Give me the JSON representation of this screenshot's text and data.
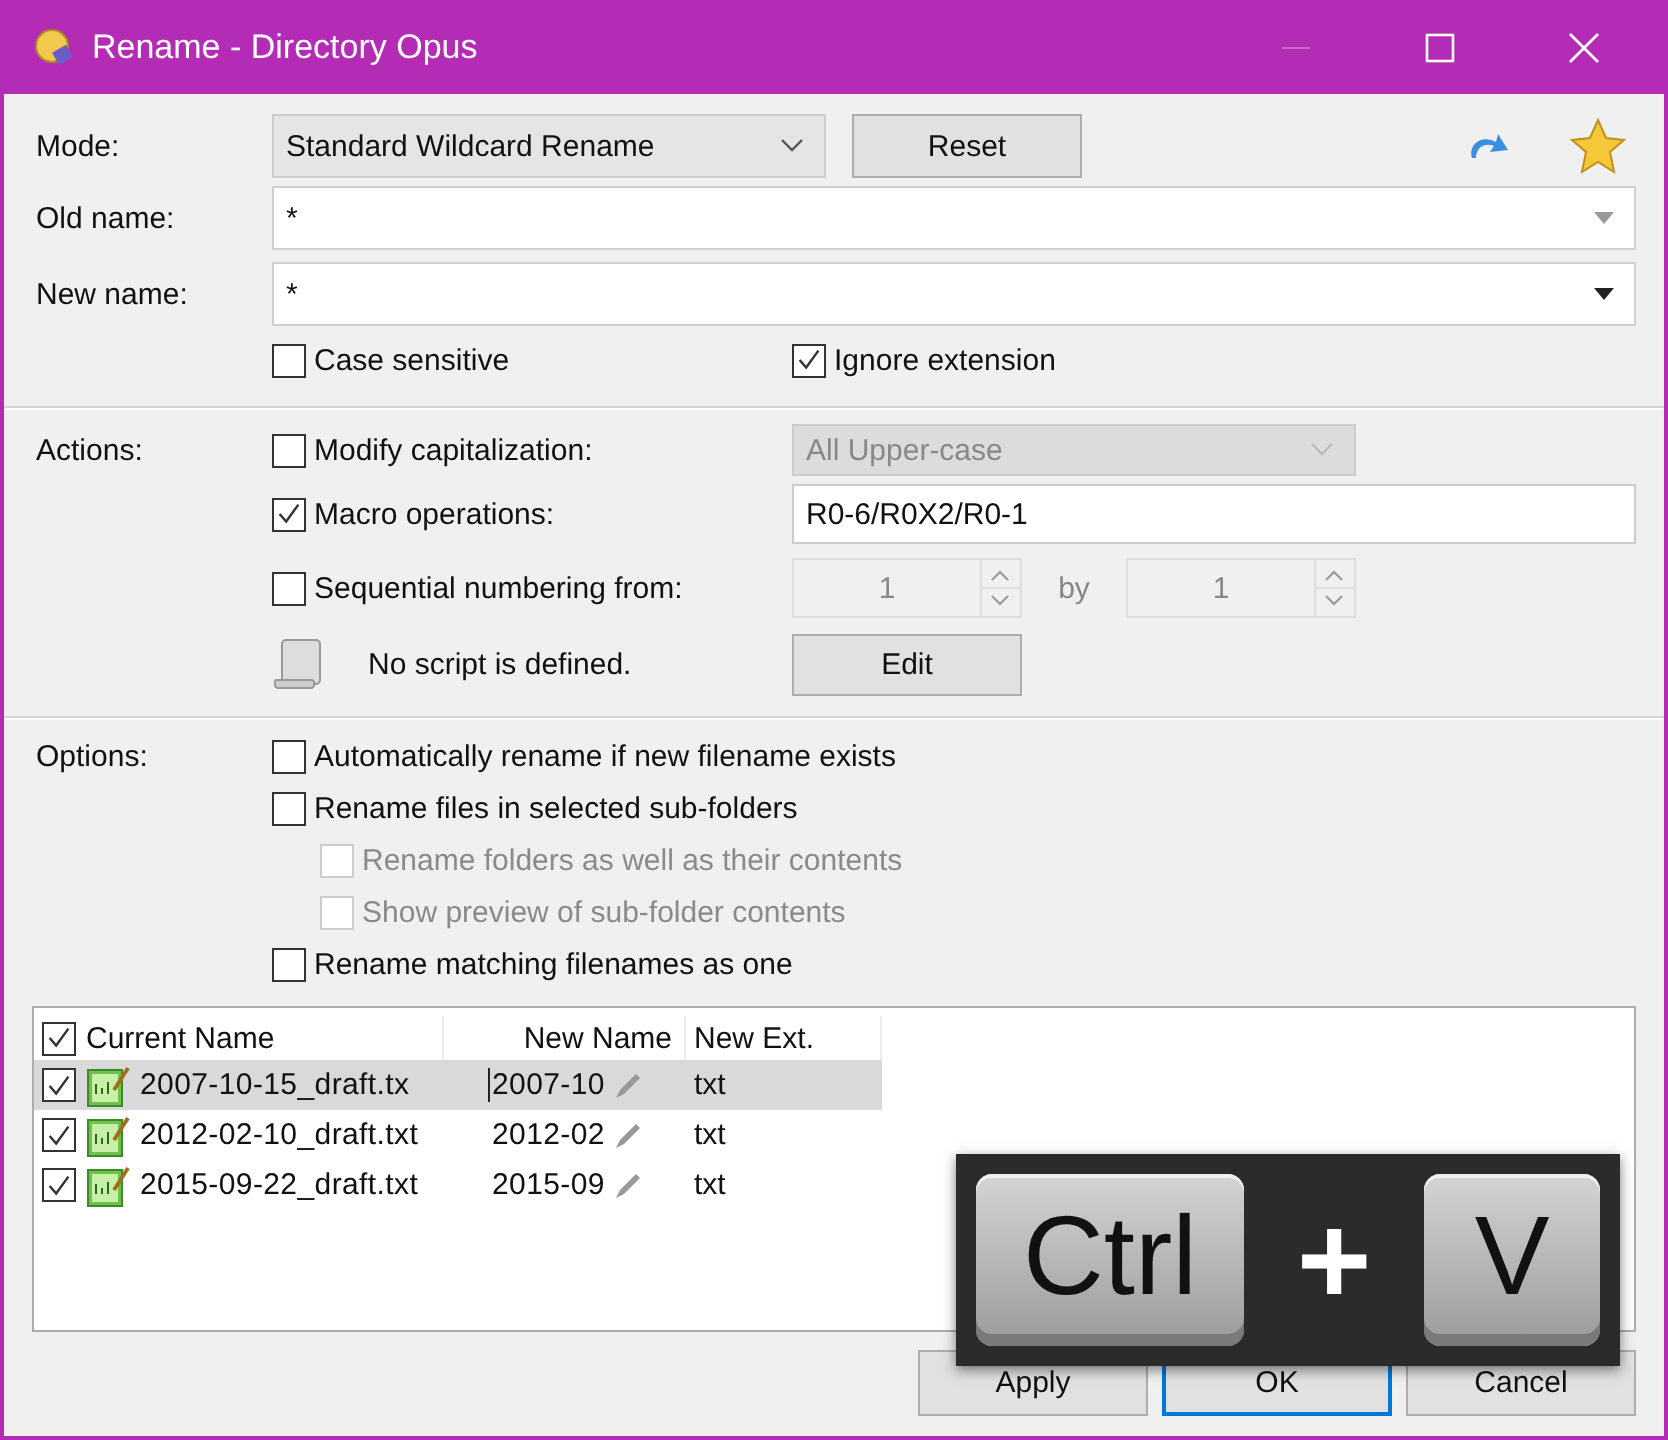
{
  "window": {
    "title": "Rename - Directory Opus"
  },
  "mode": {
    "label": "Mode:",
    "value": "Standard Wildcard Rename"
  },
  "reset_button": "Reset",
  "old_name": {
    "label": "Old name:",
    "value": "*"
  },
  "new_name": {
    "label": "New name:",
    "value": "*"
  },
  "name_options": [
    {
      "label": "Case sensitive",
      "checked": false
    },
    {
      "label": "Ignore extension",
      "checked": true
    }
  ],
  "actions": {
    "label": "Actions:",
    "modify_capitalization": {
      "label": "Modify capitalization:",
      "checked": false,
      "value": "All Upper-case"
    },
    "macro_operations": {
      "label": "Macro operations:",
      "checked": true,
      "value": "R0-6/R0X2/R0-1"
    },
    "sequential_numbering": {
      "label": "Sequential numbering from:",
      "checked": false,
      "from": "1",
      "by_label": "by",
      "by": "1"
    },
    "script": {
      "text": "No script is defined.",
      "button": "Edit"
    }
  },
  "options": {
    "label": "Options:",
    "items": [
      {
        "label": "Automatically rename if new filename exists",
        "checked": false,
        "disabled": false
      },
      {
        "label": "Rename files in selected sub-folders",
        "checked": false,
        "disabled": false,
        "children": [
          {
            "label": "Rename folders as well as their contents",
            "checked": false,
            "disabled": true
          },
          {
            "label": "Show preview of sub-folder contents",
            "checked": false,
            "disabled": true
          }
        ]
      },
      {
        "label": "Rename matching filenames as one",
        "checked": false,
        "disabled": false
      }
    ]
  },
  "file_list": {
    "all_checked": true,
    "columns": [
      "Current Name",
      "New Name",
      "New Ext."
    ],
    "rows": [
      {
        "checked": true,
        "selected": true,
        "current_name": "2007-10-15_draft.tx",
        "new_name": "2007-10",
        "new_ext": "txt"
      },
      {
        "checked": true,
        "selected": false,
        "current_name": "2012-02-10_draft.txt",
        "new_name": "2012-02",
        "new_ext": "txt"
      },
      {
        "checked": true,
        "selected": false,
        "current_name": "2015-09-22_draft.txt",
        "new_name": "2015-09",
        "new_ext": "txt"
      }
    ]
  },
  "buttons": [
    {
      "label": "Apply",
      "default": false
    },
    {
      "label": "OK",
      "default": true
    },
    {
      "label": "Cancel",
      "default": false
    }
  ],
  "key_overlay": {
    "keys": [
      "Ctrl",
      "V"
    ],
    "separator": "+"
  }
}
